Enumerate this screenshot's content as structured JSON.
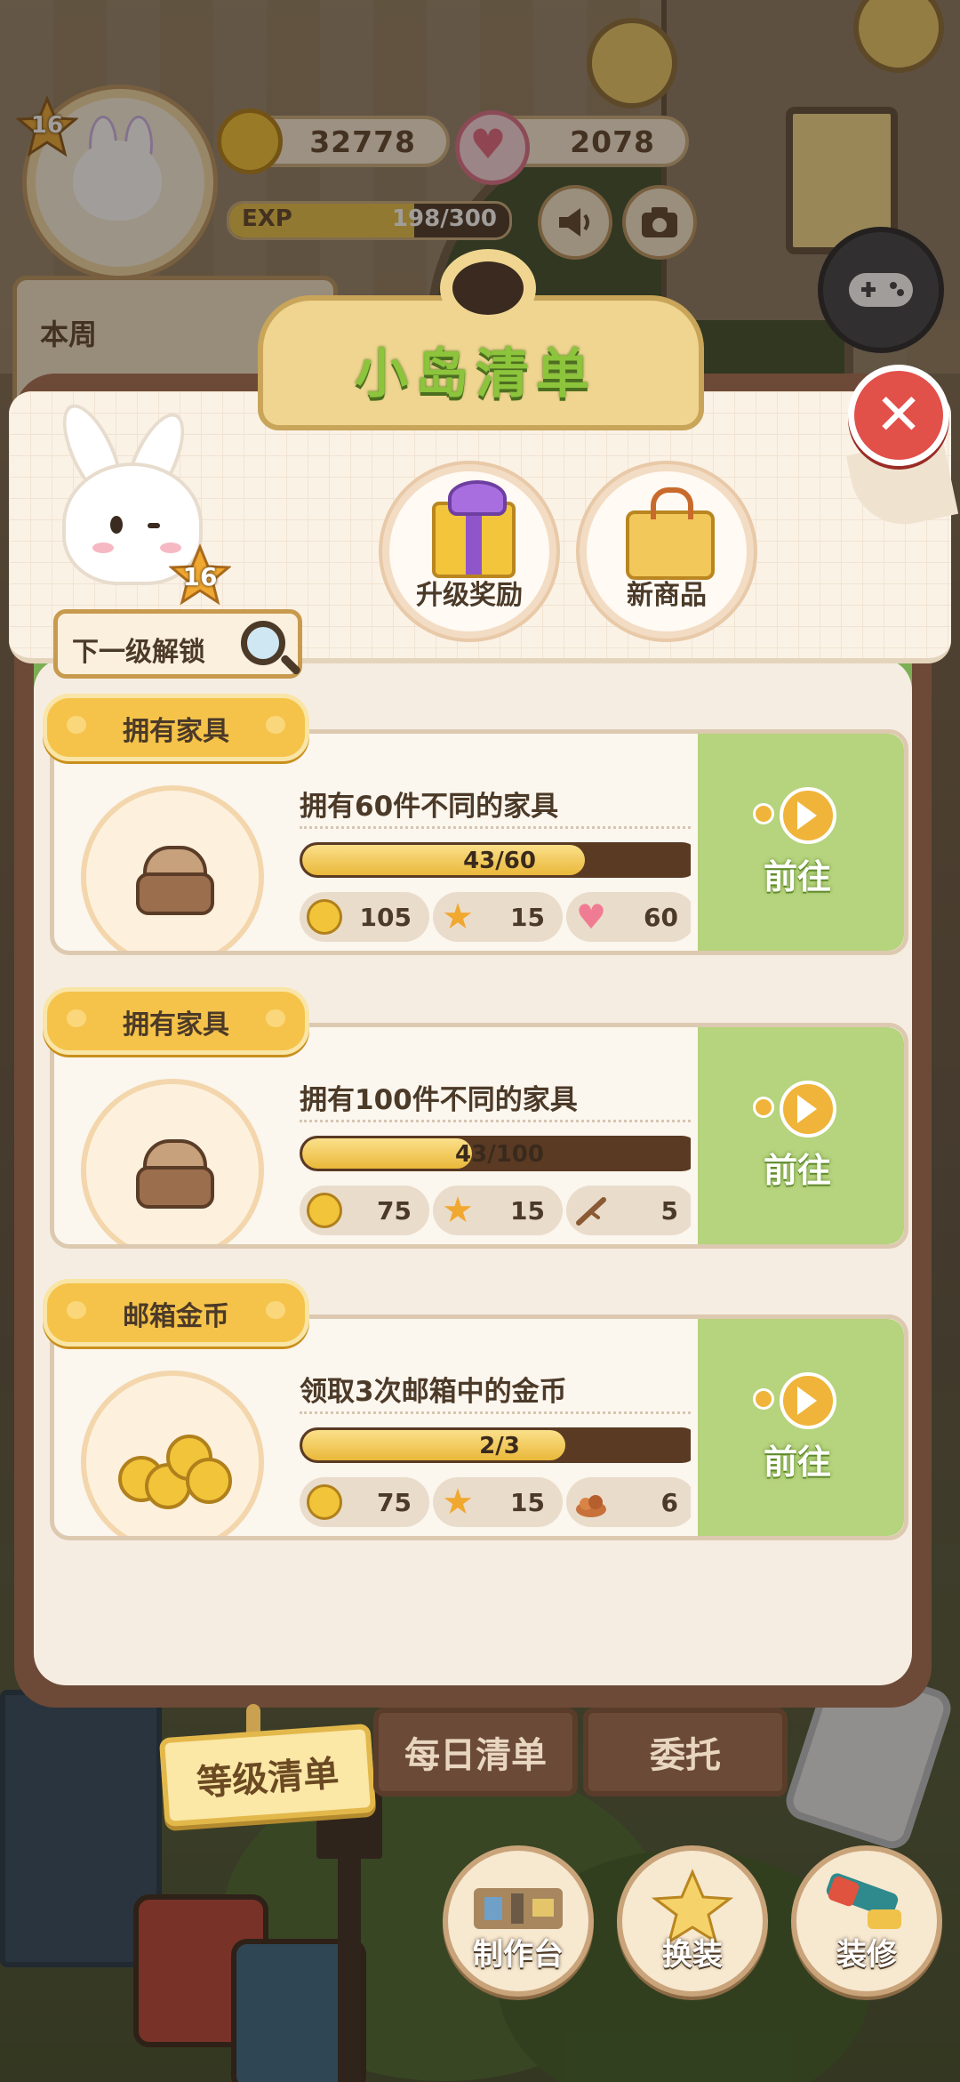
{
  "hud": {
    "level": "16",
    "coins": "32778",
    "hearts": "2078",
    "exp_label": "EXP",
    "exp_current": "198",
    "exp_total": "/300",
    "exp_progress": 0.66,
    "weekly_tab": "本周",
    "speaker_icon": "speaker-icon",
    "camera_icon": "camera-icon",
    "gamepad_icon": "gamepad-icon"
  },
  "panel": {
    "title": "小岛清单",
    "close_icon": "close-icon",
    "mascot_level": "16",
    "next_unlock_label": "下一级解锁",
    "badges": [
      {
        "label": "升级奖励",
        "icon": "gift-box-icon"
      },
      {
        "label": "新商品",
        "icon": "shopping-bag-icon"
      }
    ]
  },
  "tasks": [
    {
      "category": "拥有家具",
      "title": "拥有60件不同的家具",
      "progress_text": "43/60",
      "progress": 0.7167,
      "icon": "armchair-icon",
      "rewards": [
        {
          "icon": "coin-icon",
          "value": "105"
        },
        {
          "icon": "star-icon",
          "value": "15"
        },
        {
          "icon": "heart-icon",
          "value": "60"
        }
      ],
      "go_label": "前往"
    },
    {
      "category": "拥有家具",
      "title": "拥有100件不同的家具",
      "progress_text": "43/100",
      "progress": 0.43,
      "icon": "armchair-icon",
      "rewards": [
        {
          "icon": "coin-icon",
          "value": "75"
        },
        {
          "icon": "star-icon",
          "value": "15"
        },
        {
          "icon": "branch-icon",
          "value": "5"
        }
      ],
      "go_label": "前往"
    },
    {
      "category": "邮箱金币",
      "title": "领取3次邮箱中的金币",
      "progress_text": "2/3",
      "progress": 0.6667,
      "icon": "gold-coins-icon",
      "rewards": [
        {
          "icon": "coin-icon",
          "value": "75"
        },
        {
          "icon": "star-icon",
          "value": "15"
        },
        {
          "icon": "ore-icon",
          "value": "6"
        }
      ],
      "go_label": "前往"
    }
  ],
  "tabs": [
    {
      "label": "等级清单",
      "active": true
    },
    {
      "label": "每日清单",
      "active": false
    },
    {
      "label": "委托",
      "active": false
    }
  ],
  "bottom_buttons": [
    {
      "label": "制作台",
      "icon": "workbench-icon"
    },
    {
      "label": "换装",
      "icon": "outfit-icon"
    },
    {
      "label": "装修",
      "icon": "decorate-icon"
    }
  ],
  "colors": {
    "panel_frame": "#6d4a37",
    "accent_green": "#b6d37d",
    "progress_fill": "#eab83a",
    "tag_yellow": "#f5c34a",
    "close_red": "#e2504a"
  }
}
